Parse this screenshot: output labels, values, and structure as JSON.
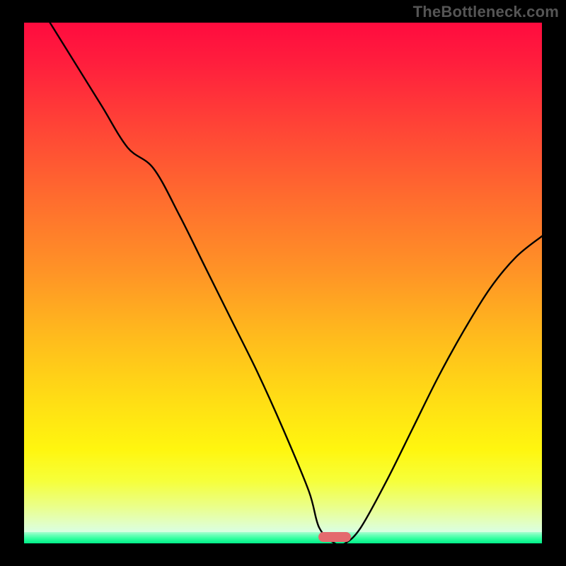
{
  "watermark": "TheBottleneck.com",
  "chart_data": {
    "type": "line",
    "title": "",
    "xlabel": "",
    "ylabel": "",
    "xlim": [
      0,
      100
    ],
    "ylim": [
      0,
      100
    ],
    "grid": false,
    "legend": false,
    "series": [
      {
        "name": "bottleneck-curve",
        "x": [
          5,
          10,
          15,
          20,
          25,
          30,
          35,
          40,
          45,
          50,
          55,
          57,
          60,
          62,
          65,
          70,
          75,
          80,
          85,
          90,
          95,
          100
        ],
        "y": [
          100,
          92,
          84,
          76,
          72,
          63,
          53,
          43,
          33,
          22,
          10,
          3,
          0,
          0,
          3,
          12,
          22,
          32,
          41,
          49,
          55,
          59
        ]
      }
    ],
    "optimal_x": 60,
    "background_gradient": {
      "top": "#ff0b3e",
      "bottom": "#00ec88",
      "note": "red at top through orange/yellow to green baseline; lower y = better"
    },
    "marker": {
      "color": "#e46a6e",
      "shape": "pill",
      "at_x": 60
    }
  }
}
